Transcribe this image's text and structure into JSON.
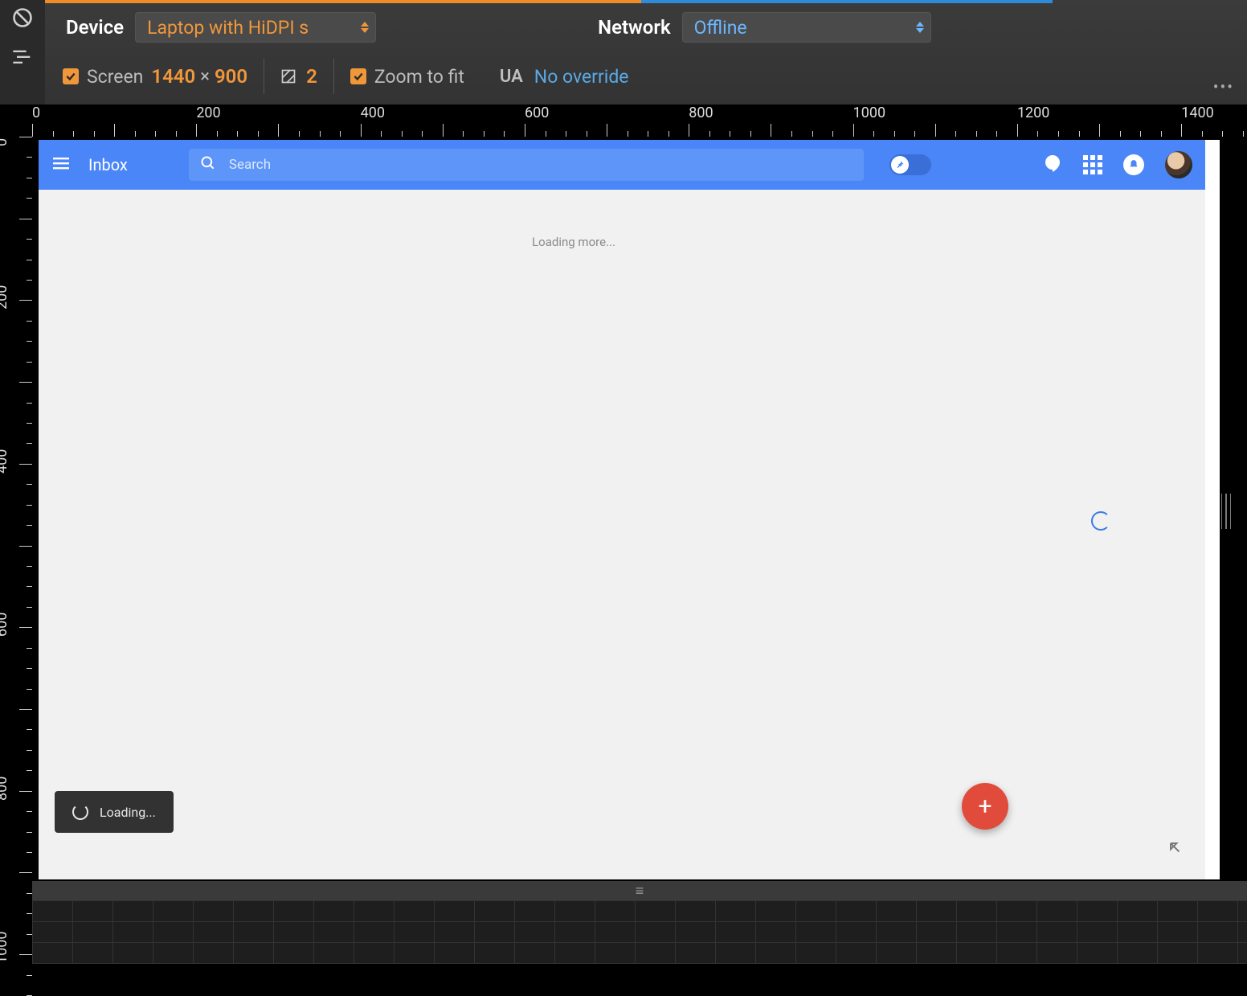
{
  "devtools": {
    "device_label": "Device",
    "device_value": "Laptop with HiDPI s",
    "network_label": "Network",
    "network_value": "Offline",
    "screen_label": "Screen",
    "width": "1440",
    "height": "900",
    "dpr": "2",
    "zoom_label": "Zoom to fit",
    "ua_label": "UA",
    "ua_value": "No override"
  },
  "ruler": {
    "h_labels": [
      "0",
      "200",
      "400",
      "600",
      "800",
      "1000",
      "1200",
      "1400"
    ],
    "v_labels": [
      "0",
      "200",
      "400",
      "600",
      "800",
      "1000"
    ]
  },
  "inbox": {
    "title": "Inbox",
    "search_placeholder": "Search",
    "loading_more": "Loading more...",
    "toast": "Loading..."
  }
}
